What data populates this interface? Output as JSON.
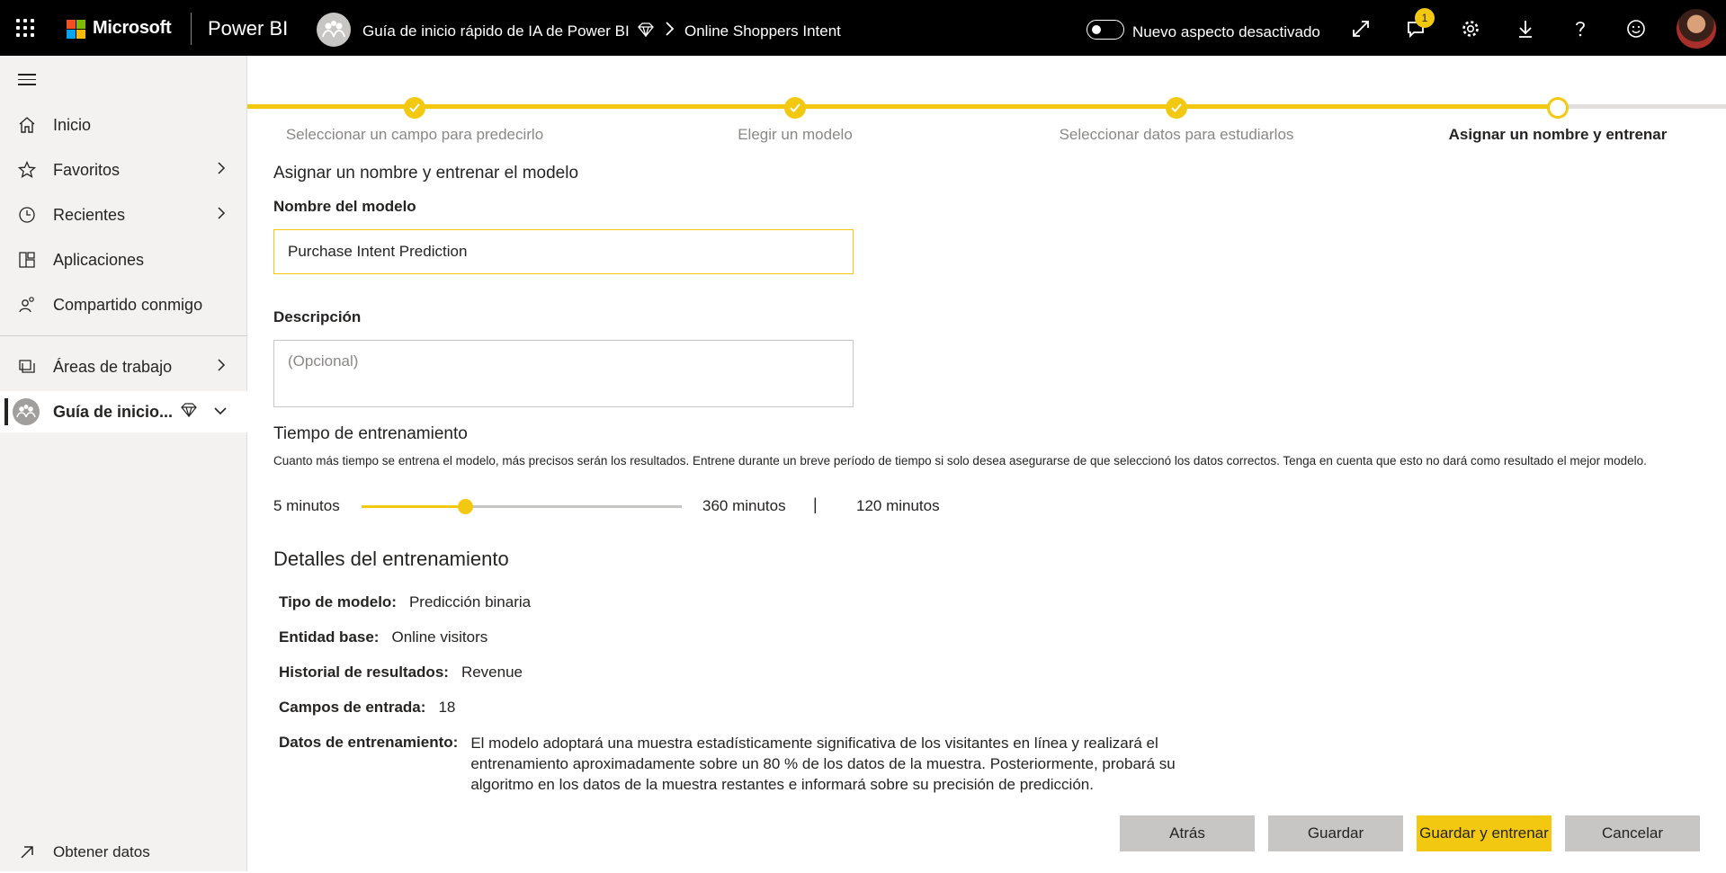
{
  "header": {
    "brand": "Microsoft",
    "product": "Power BI",
    "breadcrumb_workspace": "Guía de inicio rápido de IA de Power BI",
    "breadcrumb_item": "Online Shoppers Intent",
    "toggle_label": "Nuevo aspecto desactivado",
    "notification_count": "1",
    "icons": [
      "expand-icon",
      "notifications-icon",
      "settings-icon",
      "download-icon",
      "help-icon",
      "feedback-icon"
    ]
  },
  "sidebar": {
    "items": [
      {
        "label": "Inicio",
        "icon": "home-icon"
      },
      {
        "label": "Favoritos",
        "icon": "star-icon"
      },
      {
        "label": "Recientes",
        "icon": "clock-icon"
      },
      {
        "label": "Aplicaciones",
        "icon": "apps-icon"
      },
      {
        "label": "Compartido conmigo",
        "icon": "shared-icon"
      },
      {
        "label": "Áreas de trabajo",
        "icon": "workspaces-icon"
      },
      {
        "label": "Guía de inicio...",
        "icon": "workspace-icon"
      }
    ],
    "footer_label": "Obtener datos"
  },
  "stepper": {
    "steps": [
      {
        "label": "Seleccionar un campo para predecirlo",
        "state": "done"
      },
      {
        "label": "Elegir un modelo",
        "state": "done"
      },
      {
        "label": "Seleccionar datos para estudiarlos",
        "state": "done"
      },
      {
        "label": "Asignar un nombre y entrenar",
        "state": "current"
      }
    ],
    "colors": {
      "accent": "#F2C811",
      "inactive": "#E1DFDD"
    }
  },
  "form": {
    "title": "Asignar un nombre y entrenar el modelo",
    "name_label": "Nombre del modelo",
    "name_value": "Purchase Intent Prediction",
    "description_label": "Descripción",
    "description_placeholder": "(Opcional)",
    "training_time_title": "Tiempo de entrenamiento",
    "training_time_help": "Cuanto más tiempo se entrena el modelo, más precisos serán los resultados. Entrene durante un breve período de tiempo si solo desea asegurarse de que seleccionó los datos correctos. Tenga en cuenta que esto no dará como resultado el mejor modelo.",
    "slider_min_label": "5 minutos",
    "slider_max_label": "360 minutos",
    "slider_separator": "|",
    "slider_value_label": "120 minutos",
    "slider_min": 5,
    "slider_max": 360,
    "slider_value": 120
  },
  "details": {
    "title": "Detalles del entrenamiento",
    "rows": [
      {
        "key": "Tipo de modelo:",
        "value": "Predicción binaria"
      },
      {
        "key": "Entidad base:",
        "value": "Online visitors"
      },
      {
        "key": "Historial de resultados:",
        "value": "Revenue"
      },
      {
        "key": "Campos de entrada:",
        "value": "18"
      },
      {
        "key": "Datos de entrenamiento:",
        "value": "El modelo adoptará una muestra estadísticamente significativa de los visitantes en línea y realizará el entrenamiento aproximadamente sobre un 80 % de los datos de la muestra. Posteriormente, probará su algoritmo en los datos de la muestra restantes e informará sobre su precisión de predicción."
      }
    ]
  },
  "buttons": {
    "back": "Atrás",
    "save": "Guardar",
    "save_train": "Guardar y entrenar",
    "cancel": "Cancelar"
  }
}
